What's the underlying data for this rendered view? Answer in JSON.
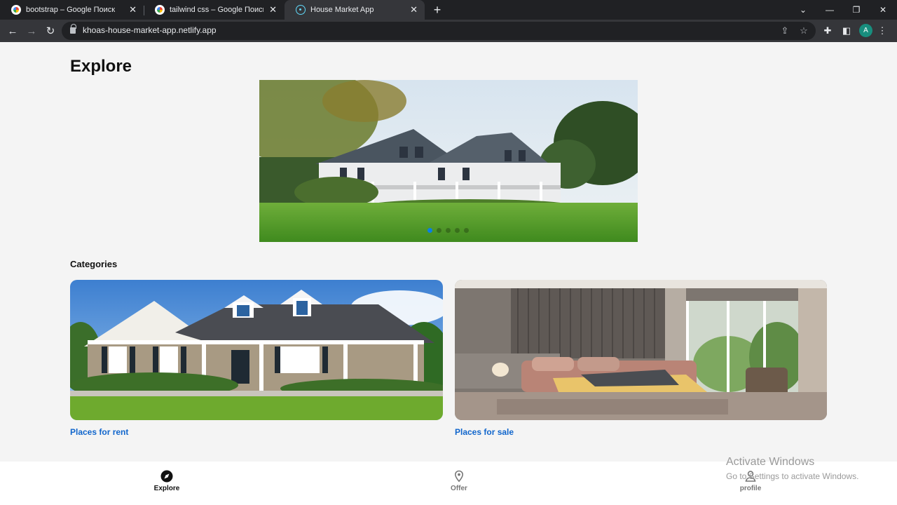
{
  "browser": {
    "tabs": [
      {
        "title": "bootstrap – Google Поиск",
        "icon": "google-icon"
      },
      {
        "title": "tailwind css – Google Поиск",
        "icon": "google-icon"
      },
      {
        "title": "House Market App",
        "icon": "react-icon"
      }
    ],
    "new_tab": "+",
    "url": "khoas-house-market-app.netlify.app",
    "avatar_letter": "A"
  },
  "page": {
    "title": "Explore",
    "slider": {
      "dot_count": 5,
      "active_dot": 0
    },
    "categories_title": "Categories",
    "categories": [
      {
        "label": "Places for rent"
      },
      {
        "label": "Places for sale"
      }
    ]
  },
  "bottom_nav": [
    {
      "label": "Explore",
      "icon": "compass-icon",
      "active": true
    },
    {
      "label": "Offer",
      "icon": "location-pin-icon",
      "active": false
    },
    {
      "label": "profile",
      "icon": "person-icon",
      "active": false
    }
  ],
  "watermark": {
    "line1": "Activate Windows",
    "line2": "Go to Settings to activate Windows."
  },
  "colors": {
    "accent": "#1166cc",
    "active_dot": "#0a7ee6",
    "chrome_dark": "#202124"
  }
}
